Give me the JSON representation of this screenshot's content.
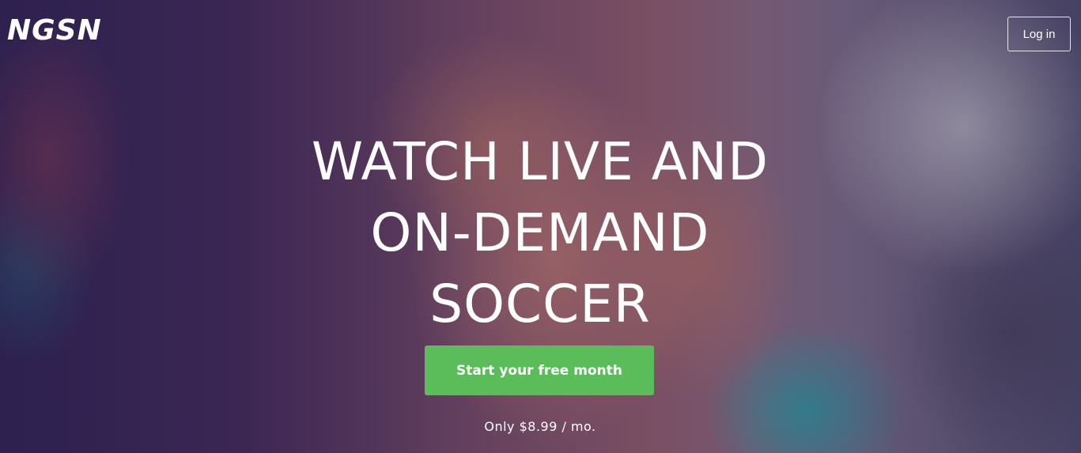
{
  "header": {
    "logo_text": "NGSN",
    "login_label": "Log in"
  },
  "hero": {
    "headline_lines": [
      "WATCH LIVE AND",
      "ON-DEMAND",
      "SOCCER"
    ],
    "cta_label": "Start your free month",
    "price_note": "Only $8.99 / mo."
  },
  "colors": {
    "cta_background": "#5bbd5a",
    "text": "#ffffff"
  }
}
